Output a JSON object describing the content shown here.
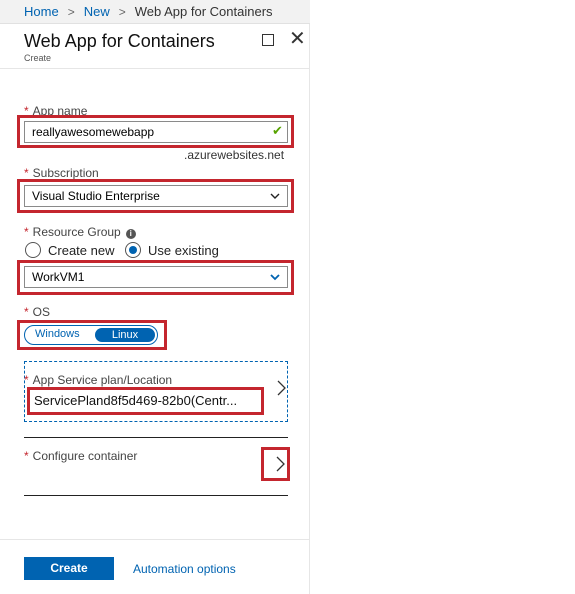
{
  "breadcrumb": {
    "home": "Home",
    "new": "New",
    "current": "Web App for Containers",
    "separator": ">"
  },
  "blade": {
    "title": "Web App for Containers",
    "subtitle": "Create",
    "close_glyph": "✕"
  },
  "app_name": {
    "label": "App name",
    "required_mark": "*",
    "value": "reallyawesomewebapp",
    "suffix": ".azurewebsites.net",
    "valid_glyph": "✔"
  },
  "subscription": {
    "label": "Subscription",
    "required_mark": "*",
    "selected": "Visual Studio Enterprise"
  },
  "resource_group": {
    "label": "Resource Group",
    "required_mark": "*",
    "info_glyph": "i",
    "option_new": "Create new",
    "option_existing": "Use existing",
    "selected_option": "existing",
    "selected": "WorkVM1"
  },
  "os": {
    "label": "OS",
    "required_mark": "*",
    "option_windows": "Windows",
    "option_linux": "Linux",
    "selected": "Linux"
  },
  "app_service_plan": {
    "label": "App Service plan/Location",
    "required_mark": "*",
    "value": "ServicePland8f5d469-82b0(Centr..."
  },
  "configure_container": {
    "label": "Configure container",
    "required_mark": "*"
  },
  "footer": {
    "create_label": "Create",
    "automation_label": "Automation options"
  },
  "colors": {
    "accent": "#0063b1",
    "highlight": "#c4262e",
    "valid": "#57a300"
  }
}
